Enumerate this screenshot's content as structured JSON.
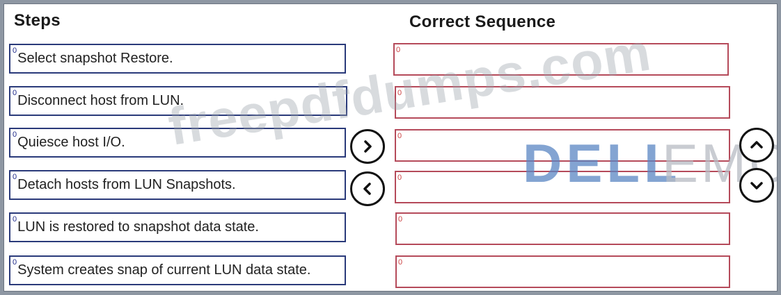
{
  "headings": {
    "steps": "Steps",
    "sequence": "Correct Sequence"
  },
  "steps": [
    {
      "index": "0",
      "label": "Select snapshot Restore."
    },
    {
      "index": "0",
      "label": "Disconnect host from LUN."
    },
    {
      "index": "0",
      "label": "Quiesce host I/O."
    },
    {
      "index": "0",
      "label": "Detach hosts from LUN Snapshots."
    },
    {
      "index": "0",
      "label": "LUN is restored to snapshot data state."
    },
    {
      "index": "0",
      "label": "System creates snap of current LUN data state."
    }
  ],
  "sequence_slots": [
    {
      "index": "0"
    },
    {
      "index": "0"
    },
    {
      "index": "0"
    },
    {
      "index": "0"
    },
    {
      "index": "0"
    },
    {
      "index": "0"
    }
  ],
  "controls": {
    "move_right": "chevron-right-icon",
    "move_left": "chevron-left-icon",
    "move_up": "chevron-up-icon",
    "move_down": "chevron-down-icon"
  },
  "watermark": {
    "text": "freepdfdumps.com"
  },
  "logo": {
    "dell": "DELL",
    "emc": "EMC"
  },
  "colors": {
    "step_border": "#2a3a7a",
    "slot_border": "#b54a5a"
  }
}
